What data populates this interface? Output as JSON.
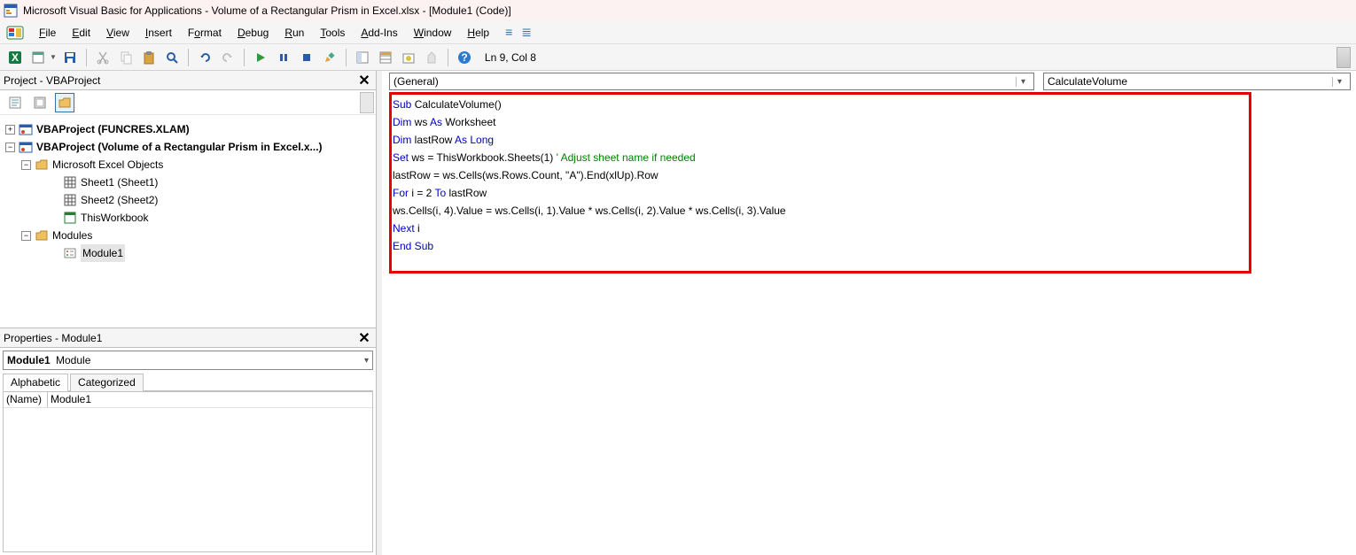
{
  "window": {
    "title": "Microsoft Visual Basic for Applications - Volume of a Rectangular Prism in Excel.xlsx - [Module1 (Code)]"
  },
  "menu": {
    "items": [
      "File",
      "Edit",
      "View",
      "Insert",
      "Format",
      "Debug",
      "Run",
      "Tools",
      "Add-Ins",
      "Window",
      "Help"
    ]
  },
  "toolbar": {
    "status": "Ln 9, Col 8"
  },
  "project_panel": {
    "title": "Project - VBAProject",
    "tree": {
      "proj1": "VBAProject (FUNCRES.XLAM)",
      "proj2": "VBAProject (Volume of a Rectangular Prism in Excel.x...)",
      "folder_objects": "Microsoft Excel Objects",
      "sheet1": "Sheet1 (Sheet1)",
      "sheet2": "Sheet2 (Sheet2)",
      "thiswb": "ThisWorkbook",
      "folder_modules": "Modules",
      "module1": "Module1"
    }
  },
  "props_panel": {
    "title": "Properties - Module1",
    "object_name": "Module1",
    "object_type": "Module",
    "tabs": {
      "alpha": "Alphabetic",
      "cat": "Categorized"
    },
    "rows": [
      {
        "k": "(Name)",
        "v": "Module1"
      }
    ]
  },
  "code_panel": {
    "combo_left": "(General)",
    "combo_right": "CalculateVolume",
    "code": {
      "l1a": "Sub",
      "l1b": " CalculateVolume()",
      "l2a": "Dim",
      "l2b": " ws ",
      "l2c": "As",
      "l2d": " Worksheet",
      "l3a": "Dim",
      "l3b": " lastRow ",
      "l3c": "As Long",
      "l4a": "Set",
      "l4b": " ws = ThisWorkbook.Sheets(1) ",
      "l4c": "' Adjust sheet name if needed",
      "l5": "lastRow = ws.Cells(ws.Rows.Count, \"A\").End(xlUp).Row",
      "l6a": "For",
      "l6b": " i = 2 ",
      "l6c": "To",
      "l6d": " lastRow",
      "l7": "ws.Cells(i, 4).Value = ws.Cells(i, 1).Value * ws.Cells(i, 2).Value * ws.Cells(i, 3).Value",
      "l8a": "Next",
      "l8b": " i",
      "l9": "End Sub"
    }
  }
}
